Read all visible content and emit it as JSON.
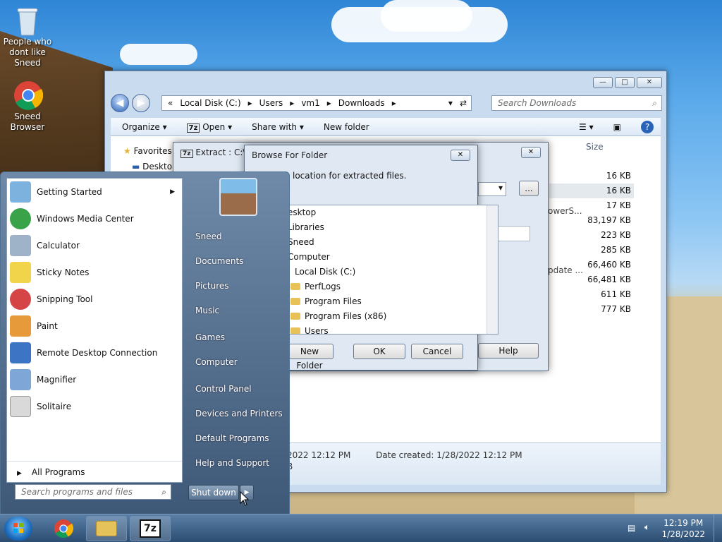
{
  "desktop": {
    "icons": [
      {
        "label": "People who dont like Sneed"
      },
      {
        "label": "Sneed Browser"
      }
    ]
  },
  "explorer": {
    "breadcrumb": [
      "«",
      "Local Disk (C:)",
      "Users",
      "vm1",
      "Downloads"
    ],
    "search_placeholder": "Search Downloads",
    "toolbar": {
      "organize": "Organize",
      "open": "Open",
      "share_with": "Share with",
      "new_folder": "New folder"
    },
    "sidebar": {
      "favorites": "Favorites",
      "desktop": "Desktop"
    },
    "column_size": "Size",
    "sizes": [
      "16 KB",
      "16 KB",
      "17 KB",
      "83,197 KB",
      "223 KB",
      "285 KB",
      "66,460 KB",
      "66,481 KB",
      "611 KB",
      "777 KB"
    ],
    "partial_names": {
      "row3": "owerS...",
      "row7": "pdate ..."
    },
    "details": {
      "date_modified": "2022 12:12 PM",
      "date_created_label": "Date created:",
      "date_created_value": "1/28/2022 12:12 PM",
      "size_frag": "B"
    }
  },
  "extract_dialog": {
    "title": "Extract : C:\\Use",
    "help": "Help",
    "browse_btn": "..."
  },
  "browse_dialog": {
    "title": "Browse For Folder",
    "prompt": "location for extracted files.",
    "tree": [
      {
        "label": "esktop",
        "indent": 0,
        "folder": false
      },
      {
        "label": "Libraries",
        "indent": 0,
        "folder": false
      },
      {
        "label": "Sneed",
        "indent": 0,
        "folder": false
      },
      {
        "label": "Computer",
        "indent": 0,
        "folder": false
      },
      {
        "label": "Local Disk (C:)",
        "indent": 1,
        "folder": false
      },
      {
        "label": "PerfLogs",
        "indent": 2,
        "folder": true
      },
      {
        "label": "Program Files",
        "indent": 2,
        "folder": true
      },
      {
        "label": "Program Files (x86)",
        "indent": 2,
        "folder": true
      },
      {
        "label": "Users",
        "indent": 2,
        "folder": true
      }
    ],
    "new_folder": "New Folder",
    "ok": "OK",
    "cancel": "Cancel"
  },
  "start_menu": {
    "programs": [
      {
        "label": "Getting Started",
        "color": "#7db2de",
        "arrow": true
      },
      {
        "label": "Windows Media Center",
        "color": "#3aa34a",
        "arrow": false
      },
      {
        "label": "Calculator",
        "color": "#9fb3c8",
        "arrow": false
      },
      {
        "label": "Sticky Notes",
        "color": "#f1d44a",
        "arrow": false
      },
      {
        "label": "Snipping Tool",
        "color": "#d64545",
        "arrow": false
      },
      {
        "label": "Paint",
        "color": "#e79a3a",
        "arrow": false
      },
      {
        "label": "Remote Desktop Connection",
        "color": "#3d74c4",
        "arrow": false
      },
      {
        "label": "Magnifier",
        "color": "#7ea6d6",
        "arrow": false
      },
      {
        "label": "Solitaire",
        "color": "#d9d9d9",
        "arrow": false
      }
    ],
    "all_programs": "All Programs",
    "search_placeholder": "Search programs and files",
    "right_items": [
      {
        "label": "Sneed"
      },
      {
        "label": "Documents"
      },
      {
        "label": "Pictures"
      },
      {
        "label": "Music"
      },
      {
        "label": "Games"
      },
      {
        "label": "Computer"
      },
      {
        "label": "Control Panel"
      },
      {
        "label": "Devices and Printers"
      },
      {
        "label": "Default Programs"
      },
      {
        "label": "Help and Support"
      }
    ],
    "shut_down": "Shut down"
  },
  "taskbar": {
    "time": "12:19 PM",
    "date": "1/28/2022",
    "sevenzip_label": "7z"
  }
}
